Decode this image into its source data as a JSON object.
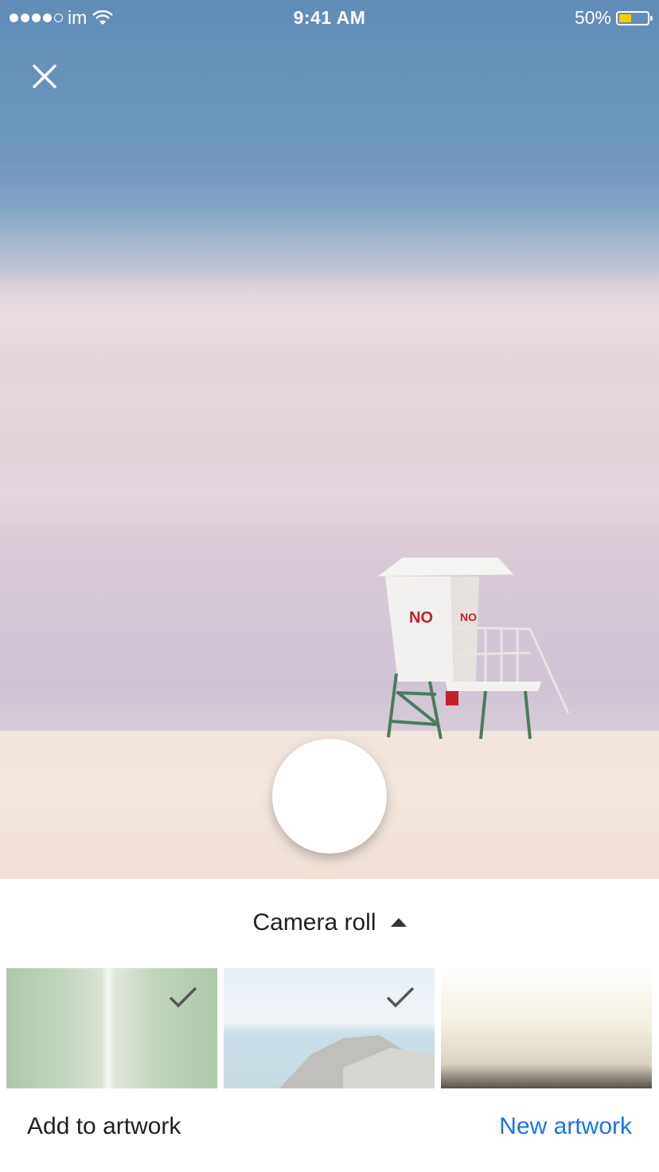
{
  "status_bar": {
    "carrier": "im",
    "time": "9:41 AM",
    "battery_percent": "50%",
    "battery_level": 0.5
  },
  "viewfinder": {
    "close_icon": "close-icon",
    "shutter_icon": "shutter-button"
  },
  "picker": {
    "album_label": "Camera roll",
    "album_caret_icon": "caret-up-icon",
    "thumbnails": [
      {
        "subject": "waterfall",
        "selected": true
      },
      {
        "subject": "coast",
        "selected": true
      },
      {
        "subject": "clouds",
        "selected": false
      }
    ]
  },
  "actions": {
    "add_label": "Add to artwork",
    "new_label": "New artwork",
    "accent_color": "#1a73e8"
  }
}
